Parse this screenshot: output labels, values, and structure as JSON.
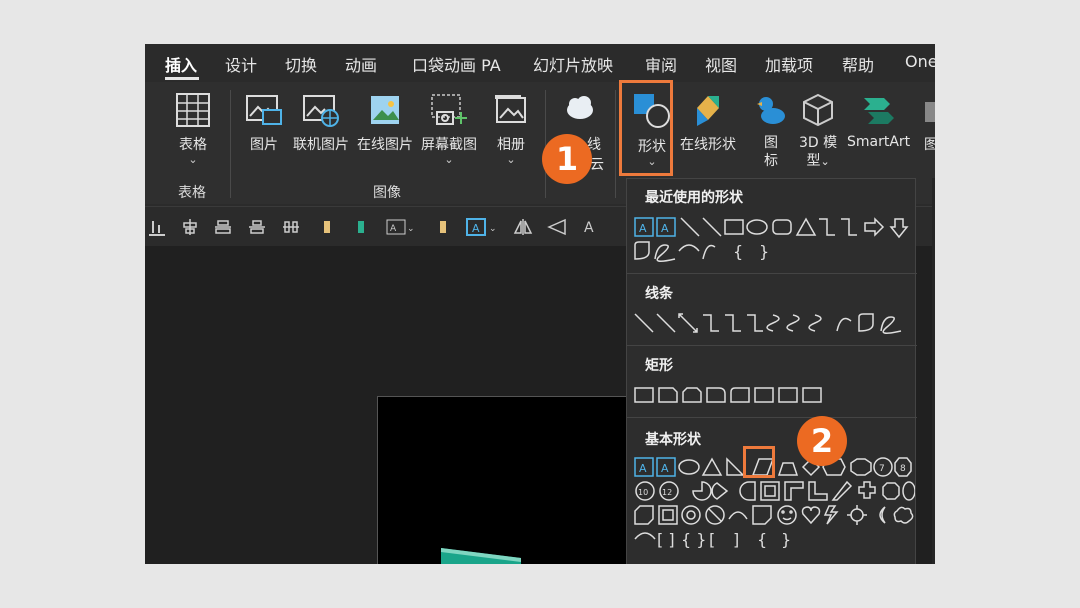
{
  "tabs": [
    "插入",
    "设计",
    "切换",
    "动画",
    "口袋动画 PA",
    "幻灯片放映",
    "审阅",
    "视图",
    "加载项",
    "帮助",
    "One"
  ],
  "active_tab": "插入",
  "ribbon": {
    "table_btn": "表格",
    "picture_btn": "图片",
    "online_picture_btn": "联机图片",
    "online_image_btn": "在线图片",
    "screenshot_btn": "屏幕截图",
    "album_btn": "相册",
    "cloud_btn_partial": "线",
    "cloud_btn_partial2": "云",
    "shapes_btn": "形状",
    "online_shapes_btn": "在线形状",
    "icons_btn_line1": "图",
    "icons_btn_line2": "标",
    "model3d_line1": "3D 模",
    "model3d_line2": "型",
    "smartart_btn": "SmartArt",
    "chart_partial": "图",
    "group_tables": "表格",
    "group_images": "图像"
  },
  "dropdown": {
    "recent": "最近使用的形状",
    "lines": "线条",
    "rect": "矩形",
    "basic": "基本形状"
  },
  "badges": {
    "step1": "1",
    "step2": "2"
  },
  "colors": {
    "accent": "#ee7a3c",
    "badge": "#ec6a22",
    "teal": "#1aa58a"
  }
}
